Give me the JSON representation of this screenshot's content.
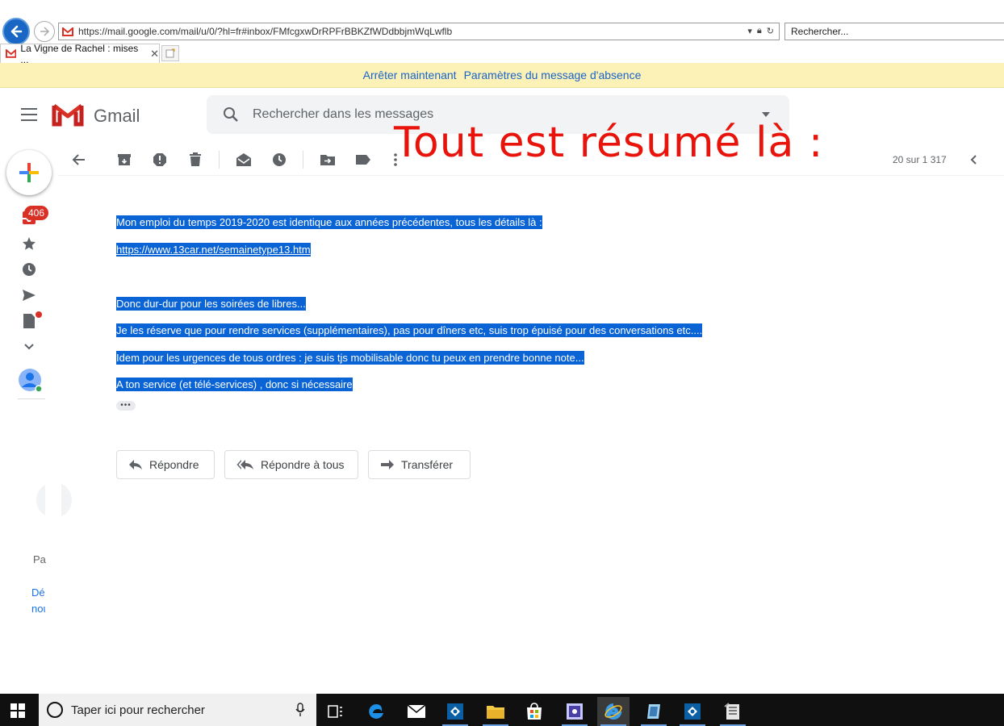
{
  "browser": {
    "url": "https://mail.google.com/mail/u/0/?hl=fr#inbox/FMfcgxwDrRPFrBBKZfWDdbbjmWqLwflb",
    "search_placeholder": "Rechercher...",
    "tab_title": "La Vigne de Rachel : mises ..."
  },
  "vacation_banner": {
    "stop_label": "Arrêter maintenant",
    "settings_label": "Paramètres du message d'absence"
  },
  "gmail": {
    "wordmark": "Gmail",
    "search_placeholder": "Rechercher dans les messages",
    "inbox_count": "406",
    "pager": "20 sur 1 317",
    "colors": {
      "brand_red": "#d93025",
      "selection": "#0a64d6",
      "link": "#1a73e8"
    }
  },
  "overlay_caption": "Tout est résumé là :",
  "message": {
    "lines": [
      "Mon emploi du temps 2019-2020 est identique aux années précédentes, tous les détails là :",
      "https://www.13car.net/semainetype13.htm",
      "Donc dur-dur pour les soirées de libres...",
      "Je les réserve que pour rendre services (supplémentaires), pas pour dîners etc, suis trop épuisé pour des conversations etc....",
      "Idem pour les urgences de tous ordres : je suis tjs mobilisable donc tu peux en prendre bonne note...",
      "A ton service (et télé-services) , donc si nécessaire"
    ],
    "trimmed": "•••"
  },
  "actions": {
    "reply": "Répondre",
    "reply_all": "Répondre à tous",
    "forward": "Transférer"
  },
  "left_rail": {
    "text_pa": "Pa",
    "text_de": "Dé",
    "text_nou": "nou"
  },
  "taskbar": {
    "search_placeholder": "Taper ici pour rechercher"
  }
}
